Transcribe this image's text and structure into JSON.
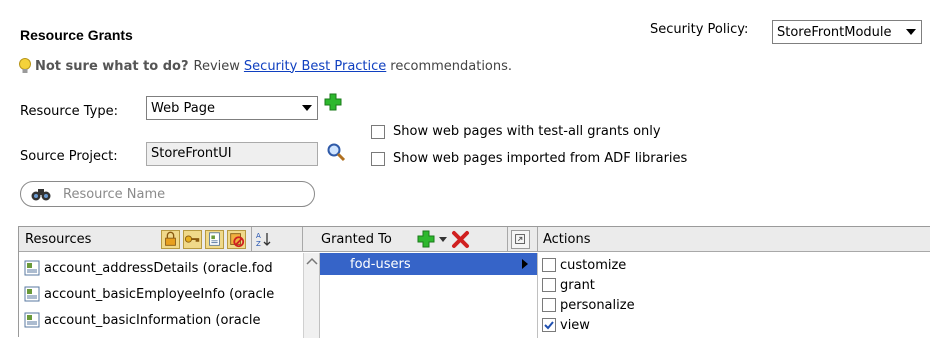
{
  "header": {
    "title": "Resource Grants",
    "hint_question": "Not sure what to do?",
    "hint_review": "Review",
    "hint_link": "Security Best Practice",
    "hint_tail": "recommendations."
  },
  "security_policy": {
    "label": "Security Policy:",
    "value": "StoreFrontModule"
  },
  "resource_type": {
    "label": "Resource Type:",
    "value": "Web Page"
  },
  "source_project": {
    "label": "Source Project:",
    "value": "StoreFrontUI"
  },
  "options": {
    "test_all": "Show web pages with test-all grants only",
    "imported": "Show web pages imported from ADF libraries"
  },
  "search": {
    "placeholder": "Resource Name"
  },
  "table": {
    "col_resources": "Resources",
    "col_granted_to": "Granted To",
    "col_actions": "Actions",
    "rows": [
      "account_addressDetails (oracle.fod",
      "account_basicEmployeeInfo (oracle",
      "account_basicInformation (oracle"
    ],
    "granted": [
      "fod-users"
    ],
    "actions": [
      {
        "label": "customize",
        "checked": false
      },
      {
        "label": "grant",
        "checked": false
      },
      {
        "label": "personalize",
        "checked": false
      },
      {
        "label": "view",
        "checked": true
      }
    ]
  },
  "colors": {
    "selection": "#3664c8",
    "link": "#1040c0",
    "add": "#2db82d",
    "remove": "#d02020"
  }
}
